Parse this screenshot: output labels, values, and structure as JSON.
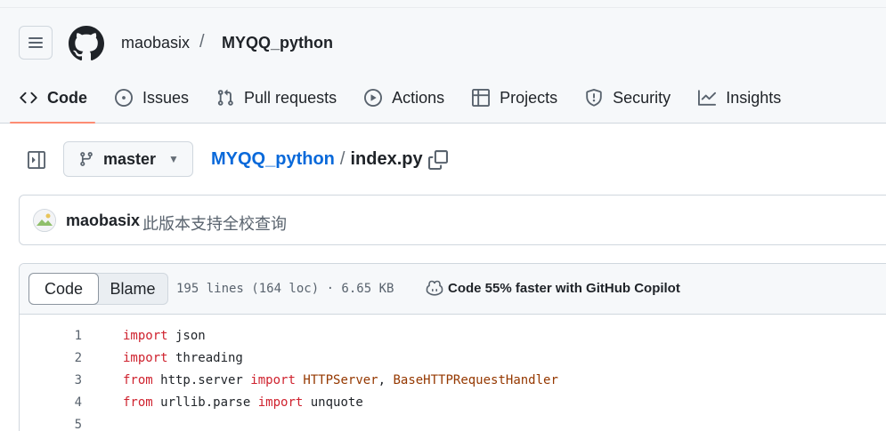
{
  "header": {
    "owner": "maobasix",
    "separator": "/",
    "repo": "MYQQ_python"
  },
  "nav": {
    "tabs": [
      {
        "label": "Code",
        "icon": "code-icon",
        "active": true
      },
      {
        "label": "Issues",
        "icon": "issue-opened-icon",
        "active": false
      },
      {
        "label": "Pull requests",
        "icon": "git-pull-request-icon",
        "active": false
      },
      {
        "label": "Actions",
        "icon": "play-icon",
        "active": false
      },
      {
        "label": "Projects",
        "icon": "table-icon",
        "active": false
      },
      {
        "label": "Security",
        "icon": "shield-icon",
        "active": false
      },
      {
        "label": "Insights",
        "icon": "graph-icon",
        "active": false
      }
    ]
  },
  "file_toolbar": {
    "branch": "master",
    "path_repo": "MYQQ_python",
    "path_sep": "/",
    "file_name": "index.py"
  },
  "commit": {
    "author": "maobasix",
    "message": "此版本支持全校查询"
  },
  "code_view": {
    "modes": [
      "Code",
      "Blame"
    ],
    "active_mode": "Code",
    "meta": "195 lines (164 loc) · 6.65 KB",
    "copilot": "Code 55% faster with GitHub Copilot",
    "lines": [
      {
        "num": "1",
        "tokens": [
          {
            "t": "import",
            "k": "kw"
          },
          {
            "t": " json",
            "k": ""
          }
        ]
      },
      {
        "num": "2",
        "tokens": [
          {
            "t": "import",
            "k": "kw"
          },
          {
            "t": " threading",
            "k": ""
          }
        ]
      },
      {
        "num": "3",
        "tokens": [
          {
            "t": "from",
            "k": "kw"
          },
          {
            "t": " http.server ",
            "k": ""
          },
          {
            "t": "import",
            "k": "kw"
          },
          {
            "t": " ",
            "k": ""
          },
          {
            "t": "HTTPServer",
            "k": "cls"
          },
          {
            "t": ", ",
            "k": ""
          },
          {
            "t": "BaseHTTPRequestHandler",
            "k": "cls"
          }
        ]
      },
      {
        "num": "4",
        "tokens": [
          {
            "t": "from",
            "k": "kw"
          },
          {
            "t": " urllib.parse ",
            "k": ""
          },
          {
            "t": "import",
            "k": "kw"
          },
          {
            "t": " unquote",
            "k": ""
          }
        ]
      },
      {
        "num": "5",
        "tokens": []
      }
    ]
  },
  "colors": {
    "link": "#0969da",
    "keyword": "#cf222e",
    "class_name": "#953800",
    "active_tab_underline": "#fd8c73"
  }
}
